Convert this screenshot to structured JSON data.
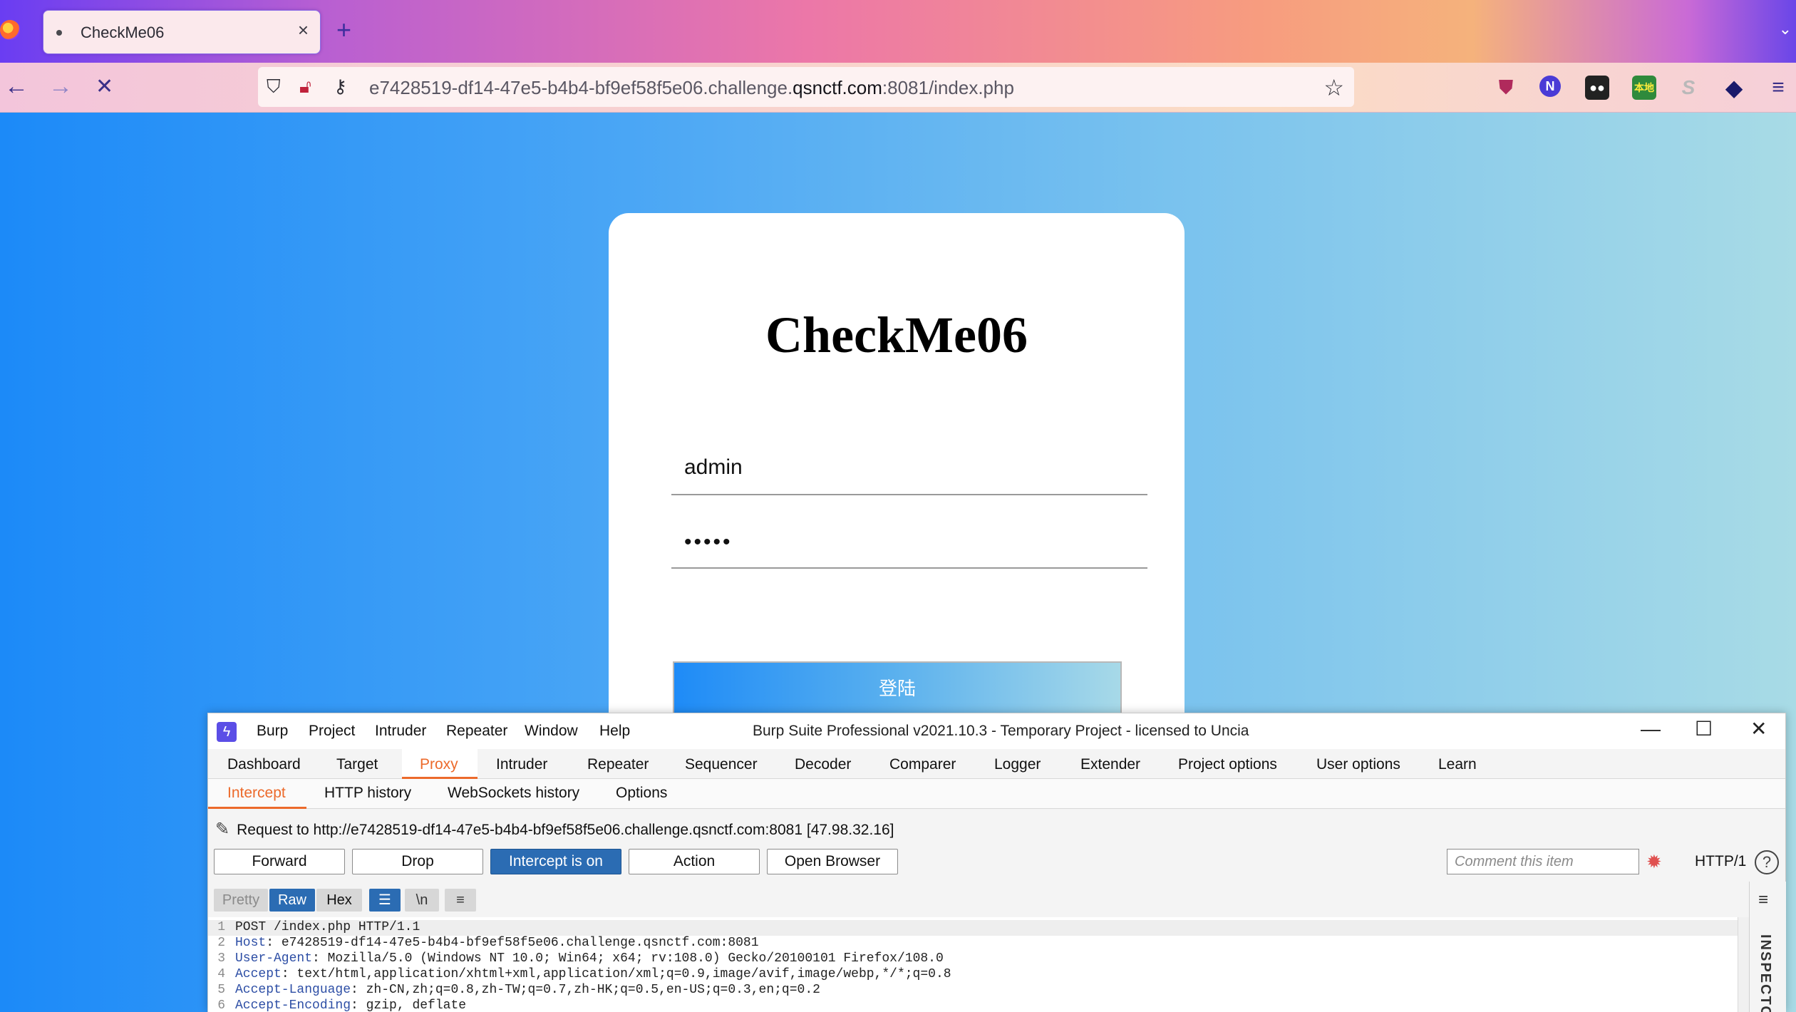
{
  "browser": {
    "tab_title": "CheckMe06",
    "tab_close": "×",
    "new_tab": "+",
    "url_host_prefix": "e7428519-df14-47e5-b4b4-bf9ef58f5e06.challenge.",
    "url_host_domain": "qsnctf.com",
    "url_rest": ":8081/index.php",
    "nav_back": "←",
    "nav_forward": "→",
    "nav_stop": "✕",
    "ext_badge_text": "本地"
  },
  "page": {
    "title": "CheckMe06",
    "username_value": "admin",
    "password_mask": "•••••",
    "login_button": "登陆"
  },
  "burp": {
    "menu": [
      "Burp",
      "Project",
      "Intruder",
      "Repeater",
      "Window",
      "Help"
    ],
    "window_title": "Burp Suite Professional v2021.10.3 - Temporary Project - licensed to Uncia",
    "window_controls": [
      "—",
      "☐",
      "✕"
    ],
    "tabs": [
      "Dashboard",
      "Target",
      "Proxy",
      "Intruder",
      "Repeater",
      "Sequencer",
      "Decoder",
      "Comparer",
      "Logger",
      "Extender",
      "Project options",
      "User options",
      "Learn"
    ],
    "active_tab": "Proxy",
    "subtabs": [
      "Intercept",
      "HTTP history",
      "WebSockets history",
      "Options"
    ],
    "active_subtab": "Intercept",
    "request_to": "Request to http://e7428519-df14-47e5-b4b4-bf9ef58f5e06.challenge.qsnctf.com:8081  [47.98.32.16]",
    "buttons": {
      "forward": "Forward",
      "drop": "Drop",
      "intercept": "Intercept is on",
      "action": "Action",
      "open_browser": "Open Browser"
    },
    "comment_placeholder": "Comment this item",
    "http_version": "HTTP/1",
    "help": "?",
    "editor_views": {
      "pretty": "Pretty",
      "raw": "Raw",
      "hex": "Hex",
      "newline": "\\n"
    },
    "inspector_label": "INSPECTOR",
    "request_lines": [
      {
        "num": "1",
        "key": "",
        "value": "POST /index.php HTTP/1.1"
      },
      {
        "num": "2",
        "key": "Host",
        "value": ": e7428519-df14-47e5-b4b4-bf9ef58f5e06.challenge.qsnctf.com:8081"
      },
      {
        "num": "3",
        "key": "User-Agent",
        "value": ": Mozilla/5.0 (Windows NT 10.0; Win64; x64; rv:108.0) Gecko/20100101 Firefox/108.0"
      },
      {
        "num": "4",
        "key": "Accept",
        "value": ": text/html,application/xhtml+xml,application/xml;q=0.9,image/avif,image/webp,*/*;q=0.8"
      },
      {
        "num": "5",
        "key": "Accept-Language",
        "value": ": zh-CN,zh;q=0.8,zh-TW;q=0.7,zh-HK;q=0.5,en-US;q=0.3,en;q=0.2"
      },
      {
        "num": "6",
        "key": "Accept-Encoding",
        "value": ": gzip, deflate"
      }
    ]
  },
  "colors": {
    "burp_accent": "#ec6a2b",
    "burp_blue": "#2b6cb3",
    "page_gradient_start": "#1c8af8",
    "page_gradient_end": "#a8dbe6"
  }
}
